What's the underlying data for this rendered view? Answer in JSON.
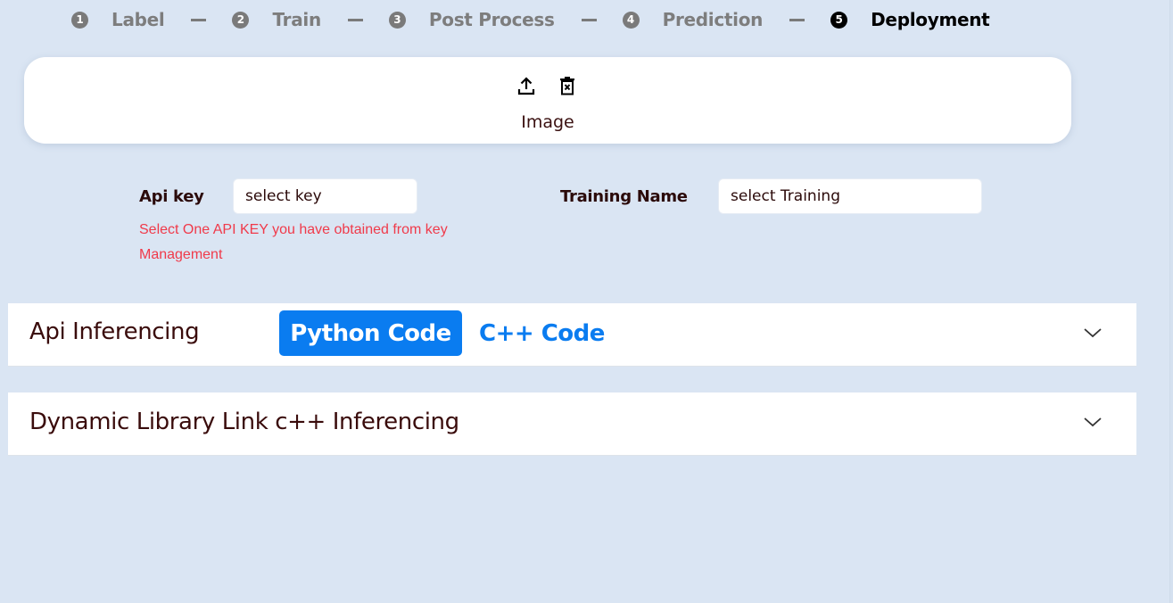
{
  "stepper": {
    "steps": [
      {
        "number": "1",
        "label": "Label",
        "active": false
      },
      {
        "number": "2",
        "label": "Train",
        "active": false
      },
      {
        "number": "3",
        "label": "Post Process",
        "active": false
      },
      {
        "number": "4",
        "label": "Prediction",
        "active": false
      },
      {
        "number": "5",
        "label": "Deployment",
        "active": true
      }
    ]
  },
  "upload": {
    "icons": [
      "upload-icon",
      "delete-icon"
    ],
    "label": "Image"
  },
  "form": {
    "api_key": {
      "label": "Api key",
      "value": "select key"
    },
    "api_key_hint": "Select One API KEY you have obtained from key Management",
    "training_name": {
      "label": "Training Name",
      "value": "select Training"
    }
  },
  "panels": {
    "api_inferencing": {
      "title": "Api Inferencing",
      "tabs": [
        {
          "label": "Python Code",
          "selected": true
        },
        {
          "label": "C++ Code",
          "selected": false
        }
      ],
      "expand_icon": "chevron-down-icon"
    },
    "dll_inferencing": {
      "title": "Dynamic Library Link c++ Inferencing",
      "expand_icon": "chevron-down-icon"
    }
  },
  "colors": {
    "background": "#dae5f3",
    "accent": "#0a7cf0",
    "hint": "#f03a4a",
    "step_inactive": "#7a7a7a",
    "step_active": "#000000"
  }
}
